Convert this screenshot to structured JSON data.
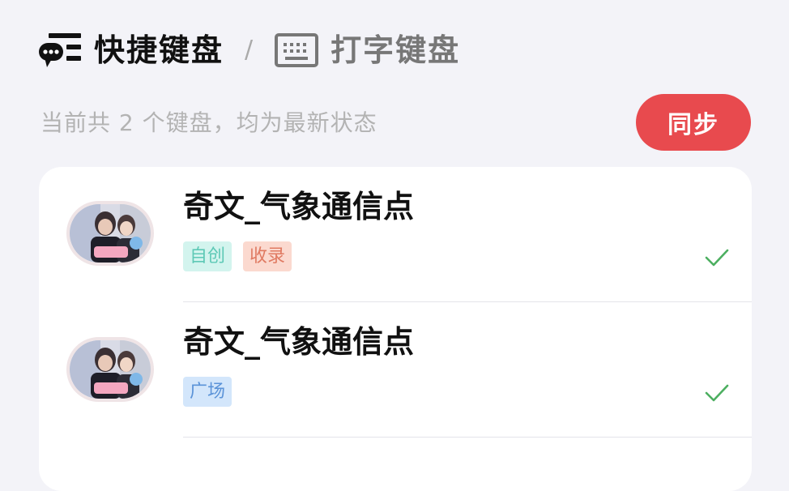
{
  "header": {
    "active_tab": "快捷键盘",
    "separator": "/",
    "inactive_tab": "打字键盘",
    "active_icon": "chat-list-icon",
    "inactive_icon": "keyboard-icon"
  },
  "summary": {
    "text": "当前共 2 个键盘，均为最新状态"
  },
  "sync_button": {
    "label": "同步",
    "color": "#e84a4e"
  },
  "keyboards": [
    {
      "title": "奇文_气象通信点",
      "tags": [
        {
          "label": "自创",
          "bg": "#d3f4ee",
          "fg": "#5ec9b6"
        },
        {
          "label": "收录",
          "bg": "#fbd9cf",
          "fg": "#e07a62"
        }
      ],
      "status_icon": "check-icon"
    },
    {
      "title": "奇文_气象通信点",
      "tags": [
        {
          "label": "广场",
          "bg": "#d3e6fb",
          "fg": "#5b93d8"
        }
      ],
      "status_icon": "check-icon"
    }
  ]
}
